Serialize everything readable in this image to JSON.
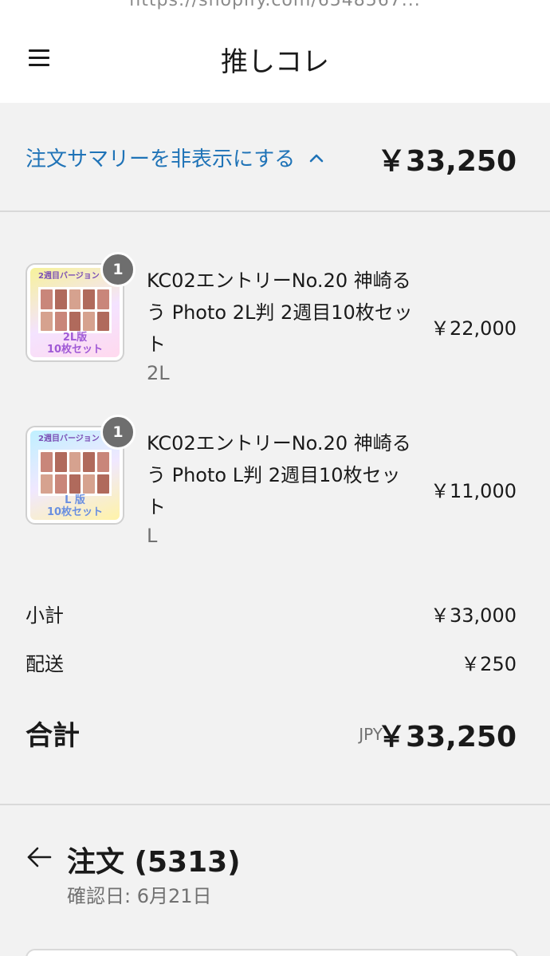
{
  "browser": {
    "url_fragment": "https://shopify.com/6548567..."
  },
  "header": {
    "menu_icon": "hamburger-menu-icon",
    "brand": "推しコレ"
  },
  "summary": {
    "toggle_label": "注文サマリーを非表示にする",
    "toggle_icon": "chevron-up-icon",
    "total": "￥33,250"
  },
  "items": [
    {
      "quantity": "1",
      "title": "KC02エントリーNo.20 神崎るう Photo 2L判 2週目10枚セット",
      "variant": "2L",
      "price": "￥22,000",
      "thumb_top": "2週目バージョン",
      "thumb_bottom_1": "2L版",
      "thumb_bottom_2": "10枚セット"
    },
    {
      "quantity": "1",
      "title": "KC02エントリーNo.20 神崎るう Photo L判 2週目10枚セット",
      "variant": "L",
      "price": "￥11,000",
      "thumb_top": "2週目バージョン",
      "thumb_bottom_1": "L 版",
      "thumb_bottom_2": "10枚セット"
    }
  ],
  "costs": {
    "subtotal_label": "小計",
    "subtotal_value": "￥33,000",
    "shipping_label": "配送",
    "shipping_value": "￥250"
  },
  "total": {
    "label": "合計",
    "currency": "JPY",
    "value": "￥33,250"
  },
  "order": {
    "back_icon": "arrow-left-icon",
    "title": "注文 (5313)",
    "confirmed_date": "確認日: 6月21日"
  },
  "colors": {
    "link": "#1f73b7",
    "badge": "#6e6e6e",
    "background": "#f2f2f2"
  }
}
